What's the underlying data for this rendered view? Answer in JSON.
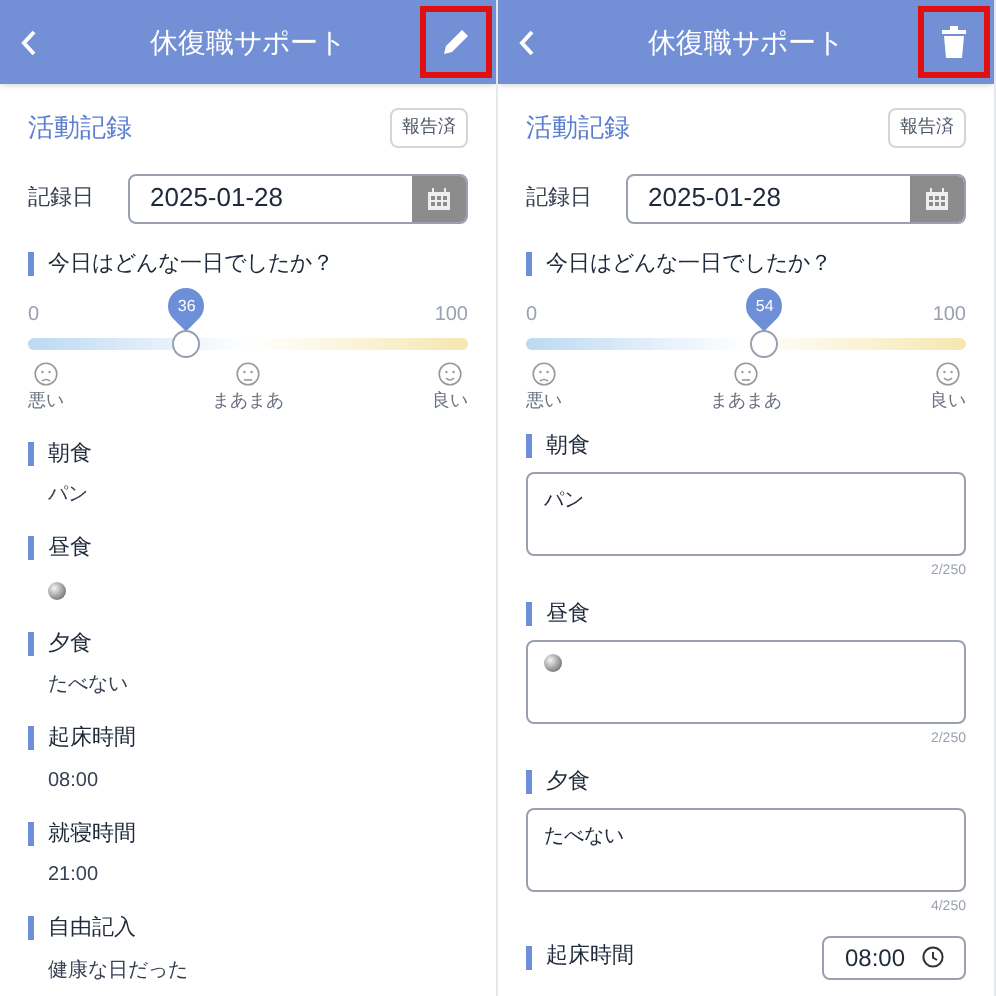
{
  "screens": [
    {
      "editing": false,
      "header": {
        "title": "休復職サポート",
        "kind": "edit",
        "highlighted": true
      },
      "section_title": "活動記録",
      "status_badge": "報告済",
      "date": {
        "label": "記録日",
        "value": "2025-01-28"
      },
      "mood": {
        "question": "今日はどんな一日でしたか？",
        "min": "0",
        "max": "100",
        "value": "36",
        "level": 0.36,
        "labels": [
          "悪い",
          "まあまあ",
          "良い"
        ]
      },
      "fields": [
        {
          "kind": "text",
          "label": "朝食",
          "value": "パン"
        },
        {
          "kind": "icon",
          "label": "昼食"
        },
        {
          "kind": "text",
          "label": "夕食",
          "value": "たべない"
        },
        {
          "kind": "text",
          "label": "起床時間",
          "value": "08:00"
        },
        {
          "kind": "text",
          "label": "就寝時間",
          "value": "21:00"
        },
        {
          "kind": "text",
          "label": "自由記入",
          "value": "健康な日だった"
        }
      ]
    },
    {
      "editing": true,
      "header": {
        "title": "休復職サポート",
        "kind": "delete",
        "highlighted": true
      },
      "section_title": "活動記録",
      "status_badge": "報告済",
      "date": {
        "label": "記録日",
        "value": "2025-01-28"
      },
      "mood": {
        "question": "今日はどんな一日でしたか？",
        "min": "0",
        "max": "100",
        "value": "54",
        "level": 0.54,
        "labels": [
          "悪い",
          "まあまあ",
          "良い"
        ]
      },
      "fields": [
        {
          "kind": "text",
          "label": "朝食",
          "value": "パン",
          "counter": "2/250"
        },
        {
          "kind": "icon",
          "label": "昼食",
          "counter": "2/250"
        },
        {
          "kind": "text",
          "label": "夕食",
          "value": "たべない",
          "counter": "4/250"
        },
        {
          "kind": "time",
          "label": "起床時間",
          "value": "08:00"
        }
      ]
    }
  ]
}
